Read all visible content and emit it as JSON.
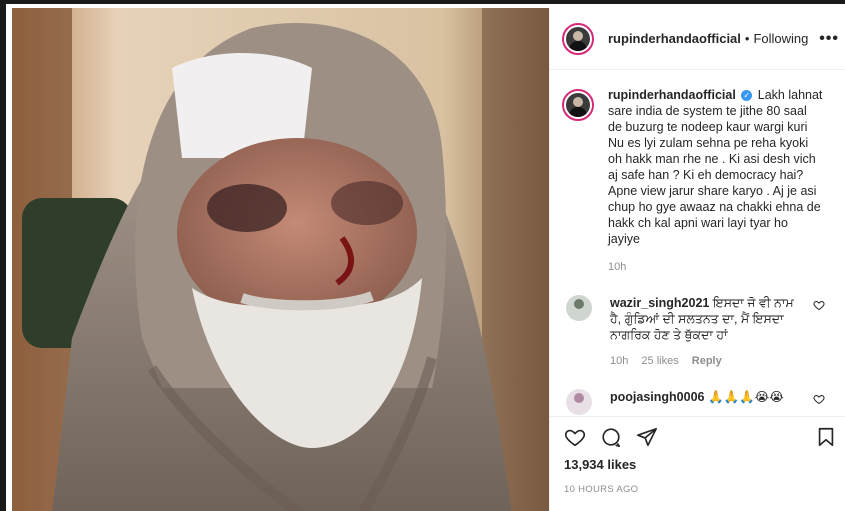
{
  "post": {
    "username": "rupinderhandaofficial",
    "follow_status": "Following",
    "more_label": "•••",
    "caption_username": "rupinderhandaofficial",
    "caption_text": "Lakh lahnat sare india de system te jithe 80 saal de buzurg te nodeep kaur wargi kuri Nu es lyi zulam sehna pe reha kyoki oh hakk man rhe ne . Ki asi desh vich aj safe han ? Ki eh democracy hai? Apne view jarur share karyo . Aj je asi chup ho gye awaaz na chakki ehna de hakk ch kal apni wari layi tyar ho jayiye",
    "caption_time": "10h"
  },
  "comments": [
    {
      "username": "wazir_singh2021",
      "text": "ਇਸਦਾ ਜੋ ਵੀ ਨਾਮ ਹੈ, ਗੁੰਡਿਆਂ ਦੀ ਸਲਤਨਤ ਦਾ, ਮੈਂ ਇਸਦਾ ਨਾਗਰਿਕ ਹੋਣ ਤੇ ਥੁੱਕਦਾ ਹਾਂ",
      "time": "10h",
      "likes": "25 likes",
      "reply": "Reply"
    },
    {
      "username": "poojasingh0006",
      "text": "🙏🙏🙏😭😭"
    }
  ],
  "footer": {
    "likes": "13,934 likes",
    "time_ago": "10 HOURS AGO"
  },
  "icons": [
    "heart-icon",
    "comment-icon",
    "share-icon",
    "bookmark-icon"
  ],
  "colors": {
    "accent": "#3897f0",
    "story_ring": "#d62976"
  }
}
